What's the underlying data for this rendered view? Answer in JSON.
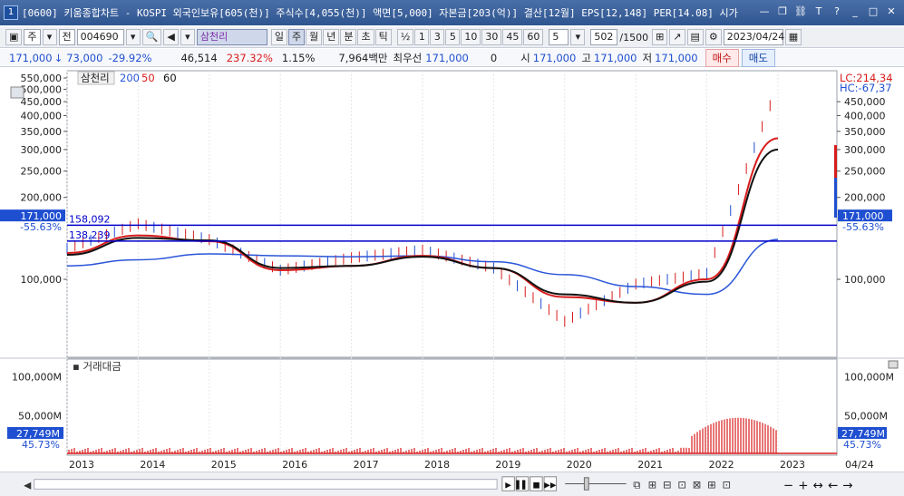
{
  "window": {
    "title": "[0600] 키움종합차트 - KOSPI 외국인보유[605(천)] 주식수[4,055(천)] 액면[5,000] 자본금[203(억)] 결산[12월] EPS[12,148] PER[14.08] 시가",
    "app_icon": "1"
  },
  "toolbar": {
    "market": "주",
    "type": "전",
    "code": "004690",
    "name": "삼천리",
    "periods": [
      "일",
      "주",
      "월",
      "년",
      "분",
      "초",
      "틱"
    ],
    "selected_period": "주",
    "nums": [
      "½",
      "1",
      "3",
      "5",
      "10",
      "30",
      "45",
      "60"
    ],
    "interval": "5",
    "count": "502",
    "total": "/1500",
    "date": "2023/04/24"
  },
  "quote": {
    "price": "171,000",
    "change": "73,000",
    "change_pct": "-29.92%",
    "volume": "46,514",
    "vol_ratio": "237.32%",
    "turnover": "1.15%",
    "amount": "7,964백만",
    "best_bid_label": "최우선",
    "best_bid": "171,000",
    "zero": "0",
    "open_label": "시",
    "open": "171,000",
    "high_label": "고",
    "high": "171,000",
    "low_label": "저",
    "low": "171,000",
    "buy": "매수",
    "sell": "매도"
  },
  "price_panel": {
    "legend_name": "삼천리",
    "ma": [
      {
        "label": "200",
        "color": "#2a55d8"
      },
      {
        "label": "50",
        "color": "#d81b1b"
      },
      {
        "label": "60",
        "color": "#111111"
      }
    ],
    "y_ticks_left": [
      "550,000",
      "500,000",
      "450,000",
      "400,000",
      "350,000",
      "300,000",
      "250,000",
      "200,000",
      "100,000"
    ],
    "y_ticks_right": [
      "450,000",
      "400,000",
      "350,000",
      "300,000",
      "250,000",
      "200,000",
      "100,000"
    ],
    "lc": "LC:214,34",
    "hc": "HC:-67,37",
    "current_tag": "171,000",
    "current_pct": "-55.63%",
    "hline1_label": "158,092",
    "hline2_label": "138,239"
  },
  "volume_panel": {
    "title": "거래대금",
    "y_ticks": [
      "100,000M",
      "50,000M"
    ],
    "current_tag": "27,749M",
    "current_pct": "45.73%"
  },
  "x_axis": {
    "years": [
      "2013",
      "2014",
      "2015",
      "2016",
      "2017",
      "2018",
      "2019",
      "2020",
      "2021",
      "2022",
      "2023"
    ],
    "right_label": "04/24"
  },
  "colors": {
    "up": "#d81b1b",
    "down": "#1f4fd1",
    "hline": "#0000cc",
    "ma200": "#2a55d8",
    "ma50": "#d81b1b",
    "ma60": "#111111"
  },
  "chart_data": {
    "type": "line",
    "title": "삼천리",
    "x": [
      "2013",
      "2014",
      "2015",
      "2016",
      "2017",
      "2018",
      "2019",
      "2020",
      "2021",
      "2022",
      "2023"
    ],
    "series": [
      {
        "name": "삼천리",
        "values": [
          130000,
          160000,
          140000,
          108000,
          120000,
          128000,
          110000,
          70000,
          96000,
          105000,
          520000
        ]
      },
      {
        "name": "200",
        "values": [
          112000,
          118000,
          124000,
          122000,
          121000,
          122000,
          116000,
          104000,
          94000,
          88000,
          140000
        ]
      },
      {
        "name": "50",
        "values": [
          125000,
          145000,
          138000,
          108000,
          112000,
          122000,
          110000,
          86000,
          82000,
          100000,
          330000
        ]
      },
      {
        "name": "60",
        "values": [
          123000,
          142000,
          139000,
          110000,
          112000,
          121000,
          110000,
          88000,
          82000,
          98000,
          300000
        ]
      }
    ],
    "volume_series": {
      "name": "거래대금",
      "unit": "M"
    }
  }
}
